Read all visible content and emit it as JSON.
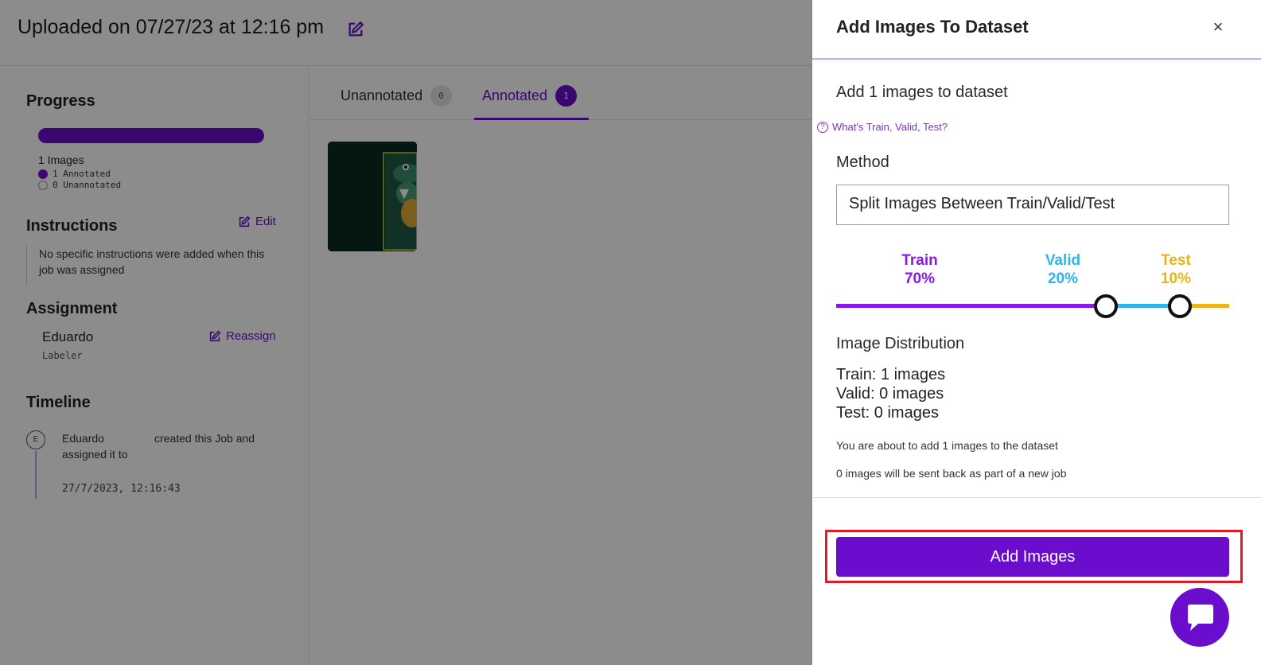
{
  "header": {
    "title": "Uploaded on 07/27/23 at 12:16 pm"
  },
  "sidebar": {
    "progress_heading": "Progress",
    "progress_fraction": 1.0,
    "images_total": "1 Images",
    "annotated": "1 Annotated",
    "unannotated": "0 Unannotated",
    "instructions_heading": "Instructions",
    "edit_label": "Edit",
    "instructions_text": "No specific instructions were added when this job was assigned",
    "assignment_heading": "Assignment",
    "assignee_name": "Eduardo",
    "assignee_role": "Labeler",
    "reassign_label": "Reassign",
    "timeline_heading": "Timeline",
    "timeline_avatar": "E",
    "timeline_actor": "Eduardo",
    "timeline_action": "created this Job and assigned it to",
    "timeline_date": "27/7/2023, 12:16:43"
  },
  "tabs": {
    "unannotated_label": "Unannotated",
    "unannotated_count": "0",
    "annotated_label": "Annotated",
    "annotated_count": "1"
  },
  "drawer": {
    "title": "Add Images To Dataset",
    "close_icon": "×",
    "add_count_text": "Add 1 images to dataset",
    "help_link": "What's Train, Valid, Test?",
    "method_label": "Method",
    "method_value": "Split Images Between Train/Valid/Test",
    "split": {
      "train_label": "Train",
      "train_pct": "70%",
      "valid_label": "Valid",
      "valid_pct": "20%",
      "test_label": "Test",
      "test_pct": "10%",
      "train_color": "#8a18e8",
      "valid_color": "#30b4ea",
      "test_color": "#e9b419"
    },
    "distribution_title": "Image Distribution",
    "dist_train": "Train: 1 images",
    "dist_valid": "Valid: 0 images",
    "dist_test": "Test: 0 images",
    "note_add": "You are about to add 1 images to the dataset",
    "note_back": "0 images will be sent back as part of a new job",
    "add_button": "Add Images"
  },
  "colors": {
    "accent": "#6a0dcc",
    "highlight_border": "#e01b24"
  }
}
